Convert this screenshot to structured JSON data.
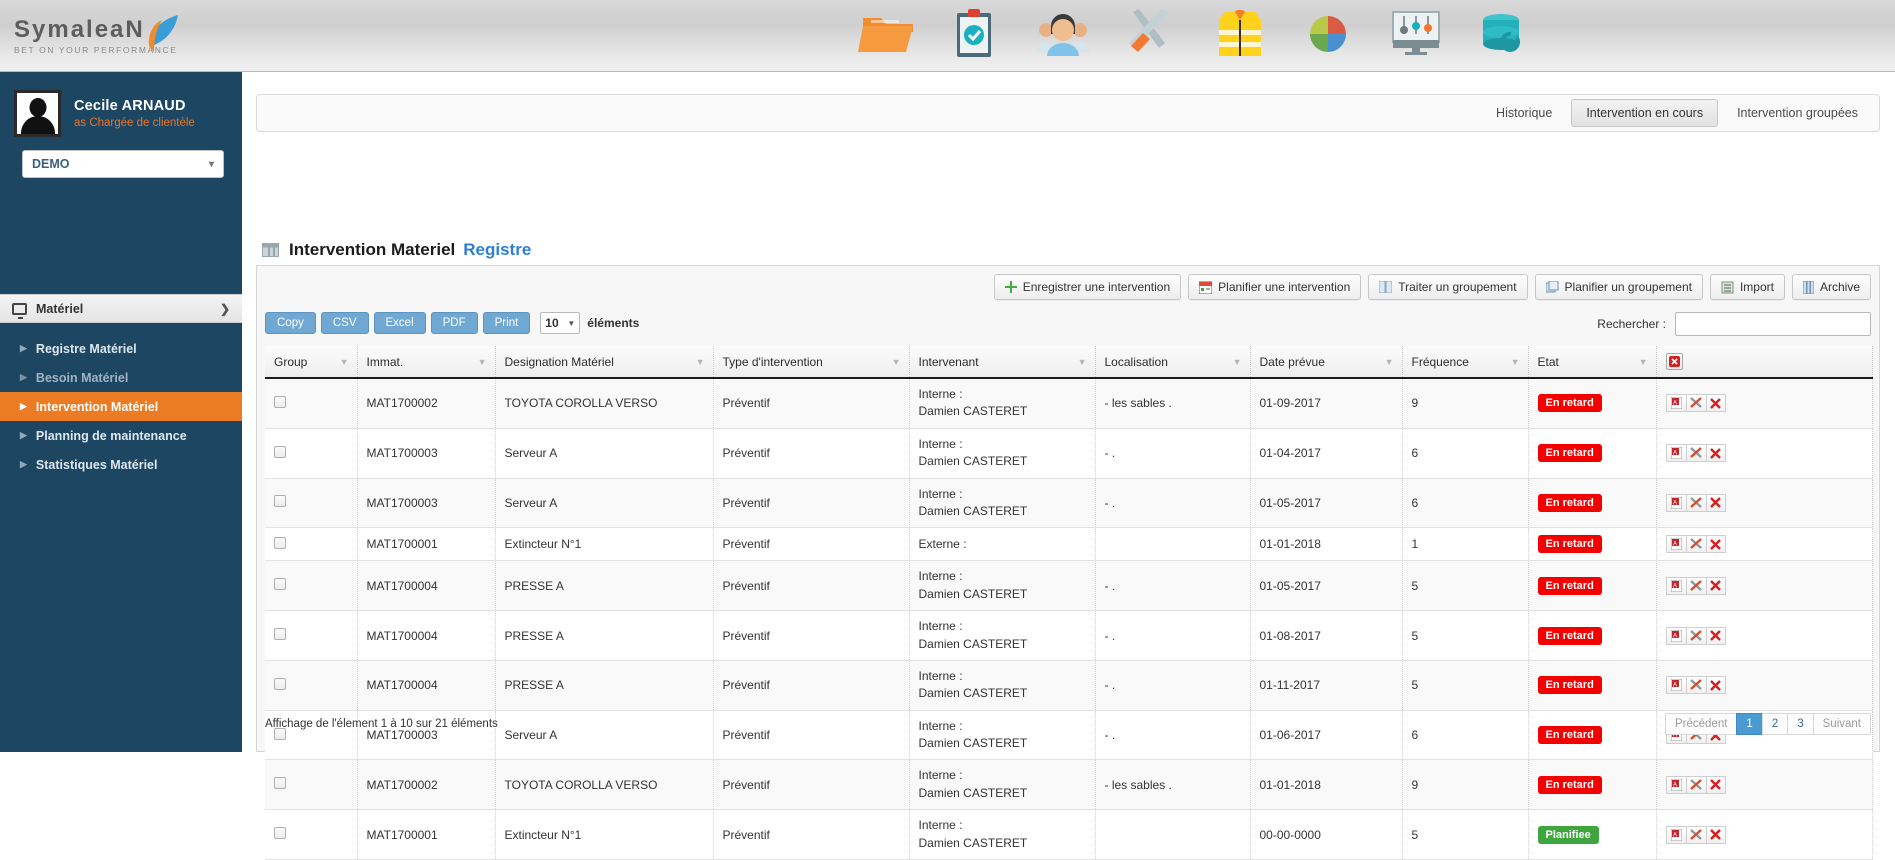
{
  "brand": {
    "name": "SymaleaN",
    "tagline": "BET ON YOUR PERFORMANCE",
    "accent": "#e8762a"
  },
  "topbar": {
    "icons": [
      {
        "name": "folder-icon",
        "label": "Dossiers"
      },
      {
        "name": "clipboard-check-icon",
        "label": "Audits"
      },
      {
        "name": "people-icon",
        "label": "Personnel"
      },
      {
        "name": "tools-icon",
        "label": "Maintenance"
      },
      {
        "name": "safety-vest-icon",
        "label": "EPI"
      },
      {
        "name": "pie-chart-icon",
        "label": "Statistiques"
      },
      {
        "name": "settings-monitor-icon",
        "label": "Paramètres"
      },
      {
        "name": "database-sync-icon",
        "label": "Données"
      }
    ]
  },
  "sidebar": {
    "user": {
      "name": "Cecile ARNAUD",
      "role": "as Chargée de clientèle"
    },
    "company_select": {
      "value": "DEMO"
    },
    "section": {
      "label": "Matériel"
    },
    "items": [
      {
        "label": "Registre Matériel",
        "state": "normal"
      },
      {
        "label": "Besoin Matériel",
        "state": "dim"
      },
      {
        "label": "Intervention Matériel",
        "state": "active"
      },
      {
        "label": "Planning de maintenance",
        "state": "normal"
      },
      {
        "label": "Statistiques Matériel",
        "state": "normal"
      }
    ]
  },
  "tabs": [
    {
      "label": "Historique",
      "active": false
    },
    {
      "label": "Intervention en cours",
      "active": true
    },
    {
      "label": "Intervention groupées",
      "active": false
    }
  ],
  "page": {
    "title": "Intervention Materiel",
    "subtitle": "Registre"
  },
  "toolbar": [
    {
      "label": "Enregistrer une intervention",
      "icon": "plus-icon"
    },
    {
      "label": "Planifier une intervention",
      "icon": "calendar-icon"
    },
    {
      "label": "Traiter un groupement",
      "icon": "book-icon"
    },
    {
      "label": "Planifier un groupement",
      "icon": "copy-icon"
    },
    {
      "label": "Import",
      "icon": "import-icon"
    },
    {
      "label": "Archive",
      "icon": "archive-icon"
    }
  ],
  "datatable_controls": {
    "export_buttons": [
      "Copy",
      "CSV",
      "Excel",
      "PDF",
      "Print"
    ],
    "page_length": "10",
    "page_length_label": "éléments",
    "search_label": "Rechercher :",
    "search_value": "",
    "search_placeholder": ""
  },
  "table": {
    "columns": [
      "Group",
      "Immat.",
      "Designation Matériel",
      "Type d'intervention",
      "Intervenant",
      "Localisation",
      "Date prévue",
      "Fréquence",
      "Etat",
      ""
    ],
    "rows": [
      {
        "immat": "MAT1700002",
        "designation": "TOYOTA COROLLA VERSO",
        "type": "Préventif",
        "intervenant_kind": "Interne :",
        "intervenant_name": "Damien CASTERET",
        "localisation": "- les sables .",
        "date": "01-09-2017",
        "frequence": "9",
        "etat": "En retard",
        "etat_color": "red"
      },
      {
        "immat": "MAT1700003",
        "designation": "Serveur A",
        "type": "Préventif",
        "intervenant_kind": "Interne :",
        "intervenant_name": "Damien CASTERET",
        "localisation": "- .",
        "date": "01-04-2017",
        "frequence": "6",
        "etat": "En retard",
        "etat_color": "red"
      },
      {
        "immat": "MAT1700003",
        "designation": "Serveur A",
        "type": "Préventif",
        "intervenant_kind": "Interne :",
        "intervenant_name": "Damien CASTERET",
        "localisation": "- .",
        "date": "01-05-2017",
        "frequence": "6",
        "etat": "En retard",
        "etat_color": "red"
      },
      {
        "immat": "MAT1700001",
        "designation": "Extincteur N°1",
        "type": "Préventif",
        "intervenant_kind": "Externe :",
        "intervenant_name": "",
        "localisation": "",
        "date": "01-01-2018",
        "frequence": "1",
        "etat": "En retard",
        "etat_color": "red"
      },
      {
        "immat": "MAT1700004",
        "designation": "PRESSE A",
        "type": "Préventif",
        "intervenant_kind": "Interne :",
        "intervenant_name": "Damien CASTERET",
        "localisation": "- .",
        "date": "01-05-2017",
        "frequence": "5",
        "etat": "En retard",
        "etat_color": "red"
      },
      {
        "immat": "MAT1700004",
        "designation": "PRESSE A",
        "type": "Préventif",
        "intervenant_kind": "Interne :",
        "intervenant_name": "Damien CASTERET",
        "localisation": "- .",
        "date": "01-08-2017",
        "frequence": "5",
        "etat": "En retard",
        "etat_color": "red"
      },
      {
        "immat": "MAT1700004",
        "designation": "PRESSE A",
        "type": "Préventif",
        "intervenant_kind": "Interne :",
        "intervenant_name": "Damien CASTERET",
        "localisation": "- .",
        "date": "01-11-2017",
        "frequence": "5",
        "etat": "En retard",
        "etat_color": "red"
      },
      {
        "immat": "MAT1700003",
        "designation": "Serveur A",
        "type": "Préventif",
        "intervenant_kind": "Interne :",
        "intervenant_name": "Damien CASTERET",
        "localisation": "- .",
        "date": "01-06-2017",
        "frequence": "6",
        "etat": "En retard",
        "etat_color": "red"
      },
      {
        "immat": "MAT1700002",
        "designation": "TOYOTA COROLLA VERSO",
        "type": "Préventif",
        "intervenant_kind": "Interne :",
        "intervenant_name": "Damien CASTERET",
        "localisation": "- les sables .",
        "date": "01-01-2018",
        "frequence": "9",
        "etat": "En retard",
        "etat_color": "red"
      },
      {
        "immat": "MAT1700001",
        "designation": "Extincteur N°1",
        "type": "Préventif",
        "intervenant_kind": "Interne :",
        "intervenant_name": "Damien CASTERET",
        "localisation": "",
        "date": "00-00-0000",
        "frequence": "5",
        "etat": "Planifiee",
        "etat_color": "green"
      }
    ]
  },
  "footer": {
    "info": "Affichage de l'élement 1 à 10 sur 21 éléments",
    "pager": [
      {
        "label": "Précédent",
        "type": "prev"
      },
      {
        "label": "1",
        "type": "current"
      },
      {
        "label": "2",
        "type": "num"
      },
      {
        "label": "3",
        "type": "num"
      },
      {
        "label": "Suivant",
        "type": "next"
      }
    ]
  }
}
